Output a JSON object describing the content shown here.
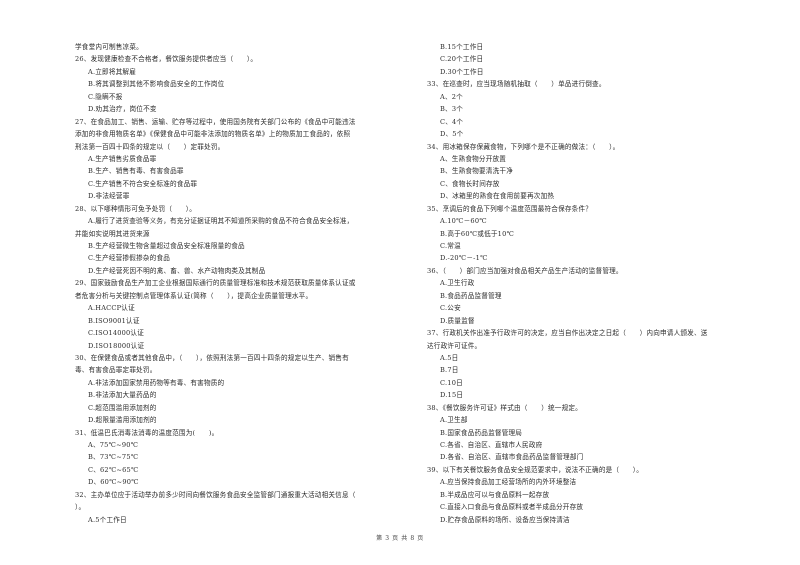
{
  "page": {
    "footer": "第 3 页 共 8 页"
  },
  "left_column": [
    {
      "type": "text",
      "text": "学食堂内可制售凉菜。"
    },
    {
      "type": "q",
      "text": "26、发现健康检查不合格者，餐饮服务提供者应当（　　）。"
    },
    {
      "type": "opt",
      "text": "A.立即将其解雇"
    },
    {
      "type": "opt",
      "text": "B.将其调整到其他不影响食品安全的工作岗位"
    },
    {
      "type": "opt",
      "text": "C.隐瞒不报"
    },
    {
      "type": "opt",
      "text": "D.劝其治疗，岗位不变"
    },
    {
      "type": "q",
      "text": "27、在食品加工、销售、运输、贮存等过程中，使用国务院有关部门公布的《食品中可能违法"
    },
    {
      "type": "q",
      "text": "添加的非食用物质名单》《保健食品中可能非法添加的物质名单》上的物质加工食品的，依照"
    },
    {
      "type": "q",
      "text": "刑法第一百四十四条的规定以（　　）定罪处罚。"
    },
    {
      "type": "opt",
      "text": "A.生产销售劣质食品罪"
    },
    {
      "type": "opt",
      "text": "B.生产、销售有毒、有害食品罪"
    },
    {
      "type": "opt",
      "text": "C.生产销售不符合安全标准的食品罪"
    },
    {
      "type": "opt",
      "text": "D.非法经营罪"
    },
    {
      "type": "q",
      "text": "28、以下哪种情形可免予处罚（　　）。"
    },
    {
      "type": "opt",
      "text": "A.履行了进货查验等义务，有充分证据证明其不知道所采购的食品不符合食品安全标准，"
    },
    {
      "type": "q",
      "text": "并能如实说明其进货来源"
    },
    {
      "type": "opt",
      "text": "B.生产经营微生物含量超过食品安全标准限量的食品"
    },
    {
      "type": "opt",
      "text": "C.生产经营掺假掺杂的食品"
    },
    {
      "type": "opt",
      "text": "D.生产经营死因不明的禽、畜、兽、水产动物肉类及其制品"
    },
    {
      "type": "q",
      "text": "29、国家鼓励食品生产加工企业根据国际通行的质量管理标准和技术规范获取质量体系认证或"
    },
    {
      "type": "q",
      "text": "者危害分析与关键控制点管理体系认证(简称（　　），提高企业质量管理水平。"
    },
    {
      "type": "opt",
      "text": "A.HACCP认证"
    },
    {
      "type": "opt",
      "text": "B.ISO9001认证"
    },
    {
      "type": "opt",
      "text": "C.ISO14000认证"
    },
    {
      "type": "opt",
      "text": "D.ISO18000认证"
    },
    {
      "type": "q",
      "text": "30、在保健食品或者其他食品中，（　　），依照刑法第一百四十四条的规定以生产、销售有"
    },
    {
      "type": "q",
      "text": "毒、有害食品罪定罪处罚。"
    },
    {
      "type": "opt",
      "text": "A.非法添加国家禁用药物等有毒、有害物质的"
    },
    {
      "type": "opt",
      "text": "B.非法添加大量药品的"
    },
    {
      "type": "opt",
      "text": "C.超范围滥用添加剂的"
    },
    {
      "type": "opt",
      "text": "D.超限量滥用添加剂的"
    },
    {
      "type": "q",
      "text": "31、低温巴氏消毒法消毒的温度范围为(　　)。"
    },
    {
      "type": "opt",
      "text": "A、75℃~90℃"
    },
    {
      "type": "opt",
      "text": "B、73℃~75℃"
    },
    {
      "type": "opt",
      "text": "C、62℃~65℃"
    },
    {
      "type": "opt",
      "text": "D、60℃~90℃"
    },
    {
      "type": "q",
      "text": "32、主办单位应于活动举办前多少时间向餐饮服务食品安全监管部门通报重大活动相关信息（"
    },
    {
      "type": "q",
      "text": "）。"
    },
    {
      "type": "opt",
      "text": "A.5个工作日"
    }
  ],
  "right_column": [
    {
      "type": "opt",
      "text": "B.15个工作日"
    },
    {
      "type": "opt",
      "text": "C.20个工作日"
    },
    {
      "type": "opt",
      "text": "D.30个工作日"
    },
    {
      "type": "q",
      "text": "33、在巡查时，应当现场随机抽取（　　）单品进行倒查。"
    },
    {
      "type": "opt",
      "text": "A、2个"
    },
    {
      "type": "opt",
      "text": "B、3个"
    },
    {
      "type": "opt",
      "text": "C、4个"
    },
    {
      "type": "opt",
      "text": "D、5个"
    },
    {
      "type": "q",
      "text": "34、用冰箱保存保藏食物，下列哪个是不正确的做法：（　　）。"
    },
    {
      "type": "opt",
      "text": "A、生熟食物分开放置"
    },
    {
      "type": "opt",
      "text": "B、生熟食物要清洗干净"
    },
    {
      "type": "opt",
      "text": "C、食物长时间存放"
    },
    {
      "type": "opt",
      "text": "D、冰箱里的熟食在食用前要再次加热"
    },
    {
      "type": "q",
      "text": "35、烹调后的食品下列哪个温度范围最符合保存条件？"
    },
    {
      "type": "opt",
      "text": "A.10℃－60℃"
    },
    {
      "type": "opt",
      "text": "B.高于60℃或低于10℃"
    },
    {
      "type": "opt",
      "text": "C.常温"
    },
    {
      "type": "opt",
      "text": "D.-20℃－-1℃"
    },
    {
      "type": "q",
      "text": "36、（　　）部门应当加强对食品相关产品生产活动的监督管理。"
    },
    {
      "type": "opt",
      "text": "A.卫生行政"
    },
    {
      "type": "opt",
      "text": "B.食品药品监督管理"
    },
    {
      "type": "opt",
      "text": "C.公安"
    },
    {
      "type": "opt",
      "text": "D.质量监督"
    },
    {
      "type": "q",
      "text": "37、行政机关作出准予行政许可的决定，应当自作出决定之日起（　　）内向申请人颁发、送"
    },
    {
      "type": "q",
      "text": "达行政许可证件。"
    },
    {
      "type": "opt",
      "text": "A.5日"
    },
    {
      "type": "opt",
      "text": "B.7日"
    },
    {
      "type": "opt",
      "text": "C.10日"
    },
    {
      "type": "opt",
      "text": "D.15日"
    },
    {
      "type": "q",
      "text": "38、《餐饮服务许可证》样式由（　　）统一规定。"
    },
    {
      "type": "opt",
      "text": "A.卫生部"
    },
    {
      "type": "opt",
      "text": "B.国家食品药品监督管理局"
    },
    {
      "type": "opt",
      "text": "C.各省、自治区、直辖市人民政府"
    },
    {
      "type": "opt",
      "text": "D.各省、自治区、直辖市食品药品监督管理部门"
    },
    {
      "type": "q",
      "text": "39、以下有关餐饮服务食品安全规范要求中，说法不正确的是（　　）。"
    },
    {
      "type": "opt",
      "text": "A.应当保持食品加工经营场所的内外环境整洁"
    },
    {
      "type": "opt",
      "text": "B.半成品应可以与食品原料一起存放"
    },
    {
      "type": "opt",
      "text": "C.直接入口食品与食品原料或者半成品分开存放"
    },
    {
      "type": "opt",
      "text": "D.贮存食品原料的场所、设备应当保持清洁"
    }
  ]
}
